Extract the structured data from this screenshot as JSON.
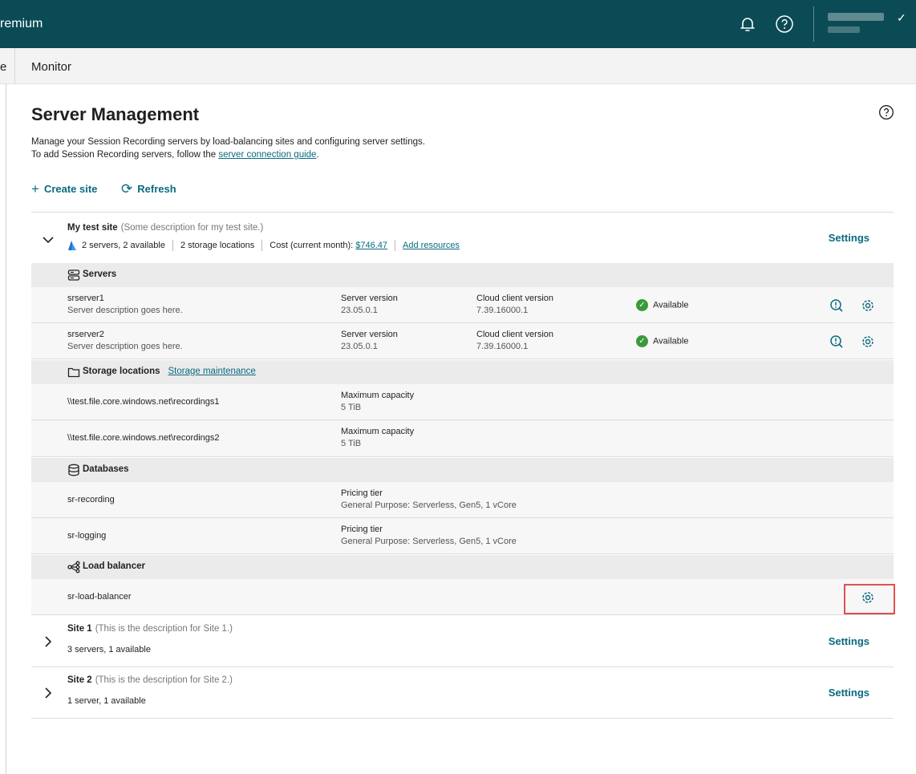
{
  "topbar": {
    "brand": "remium",
    "icons": [
      "bell-icon",
      "help-icon"
    ],
    "check": "✓"
  },
  "subnav": {
    "prev_tab": "e",
    "active_tab": "Monitor"
  },
  "page": {
    "title": "Server Management",
    "desc_line1": "Manage your Session Recording servers by load-balancing sites and configuring server settings.",
    "desc_line2_prefix": "To add Session Recording servers, follow the ",
    "desc_link": "server connection guide",
    "desc_line2_suffix": "."
  },
  "actions": {
    "create_site": "Create site",
    "refresh": "Refresh"
  },
  "site_expanded": {
    "name": "My test site",
    "description": "(Some description for my test site.)",
    "servers_summary": "2 servers, 2 available",
    "storage_summary": "2 storage locations",
    "cost_label": "Cost (current month): ",
    "cost_value": "$746.47",
    "add_resources": "Add resources",
    "settings": "Settings",
    "sections": {
      "servers": "Servers",
      "storage": "Storage locations",
      "storage_link": "Storage maintenance",
      "databases": "Databases",
      "load_balancer": "Load balancer"
    },
    "servers": [
      {
        "name": "srserver1",
        "desc": "Server description goes here.",
        "ver_label": "Server version",
        "ver": "23.05.0.1",
        "client_label": "Cloud client version",
        "client": "7.39.16000.1",
        "status": "Available"
      },
      {
        "name": "srserver2",
        "desc": "Server description goes here.",
        "ver_label": "Server version",
        "ver": "23.05.0.1",
        "client_label": "Cloud client version",
        "client": "7.39.16000.1",
        "status": "Available"
      }
    ],
    "storage": [
      {
        "path": "\\\\test.file.core.windows.net\\recordings1",
        "cap_label": "Maximum capacity",
        "cap": "5 TiB"
      },
      {
        "path": "\\\\test.file.core.windows.net\\recordings2",
        "cap_label": "Maximum capacity",
        "cap": "5 TiB"
      }
    ],
    "databases": [
      {
        "name": "sr-recording",
        "tier_label": "Pricing tier",
        "tier": "General Purpose: Serverless, Gen5, 1 vCore"
      },
      {
        "name": "sr-logging",
        "tier_label": "Pricing tier",
        "tier": "General Purpose: Serverless, Gen5, 1 vCore"
      }
    ],
    "load_balancer": {
      "name": "sr-load-balancer"
    }
  },
  "sites_collapsed": [
    {
      "name": "Site 1",
      "description": "(This is the description for Site 1.)",
      "summary": "3 servers, 1 available",
      "settings": "Settings"
    },
    {
      "name": "Site 2",
      "description": "(This is the description for Site 2.)",
      "summary": "1 server, 1 available",
      "settings": "Settings"
    }
  ],
  "colors": {
    "header_bg": "#0b4b55",
    "link": "#0a6a80",
    "available": "#3a9a3a",
    "highlight": "#e05050"
  }
}
